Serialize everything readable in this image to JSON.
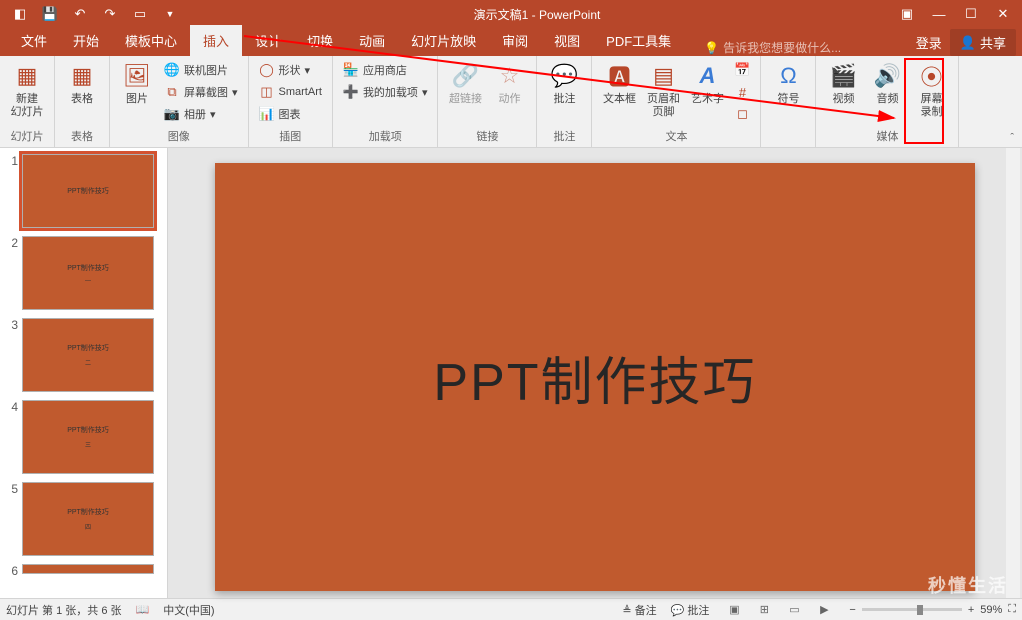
{
  "titlebar": {
    "title": "演示文稿1 - PowerPoint"
  },
  "tabs": {
    "file": "文件",
    "home": "开始",
    "template": "模板中心",
    "insert": "插入",
    "design": "设计",
    "transition": "切换",
    "animation": "动画",
    "slideshow": "幻灯片放映",
    "review": "审阅",
    "view": "视图",
    "pdf": "PDF工具集",
    "tell_me": "告诉我您想要做什么...",
    "login": "登录",
    "share": "共享"
  },
  "ribbon": {
    "slides": {
      "new_slide": "新建\n幻灯片",
      "group": "幻灯片"
    },
    "tables": {
      "table": "表格",
      "group": "表格"
    },
    "images": {
      "pictures": "图片",
      "online_pic": "联机图片",
      "screenshot": "屏幕截图",
      "album": "相册",
      "group": "图像"
    },
    "illustrations": {
      "shapes": "形状",
      "smartart": "SmartArt",
      "chart": "图表",
      "group": "插图"
    },
    "addins": {
      "store": "应用商店",
      "my_addins": "我的加载项",
      "group": "加载项"
    },
    "links": {
      "hyperlink": "超链接",
      "action": "动作",
      "group": "链接"
    },
    "comments": {
      "comment": "批注",
      "group": "批注"
    },
    "text": {
      "textbox": "文本框",
      "header_footer": "页眉和页脚",
      "wordart": "艺术字",
      "group": "文本"
    },
    "symbols": {
      "symbol": "符号"
    },
    "media": {
      "video": "视频",
      "audio": "音频",
      "screen_rec": "屏幕\n录制",
      "group": "媒体"
    }
  },
  "slide": {
    "title": "PPT制作技巧",
    "thumb_title": "PPT制作技巧",
    "sub2": "二",
    "sub3": "三",
    "sub4": "三",
    "sub5": "四"
  },
  "thumbs": [
    "1",
    "2",
    "3",
    "4",
    "5",
    "6"
  ],
  "statusbar": {
    "slide_info": "幻灯片 第 1 张，共 6 张",
    "language": "中文(中国)",
    "notes": "备注",
    "comments": "批注",
    "zoom": "59%"
  },
  "watermark": "秒懂生活"
}
